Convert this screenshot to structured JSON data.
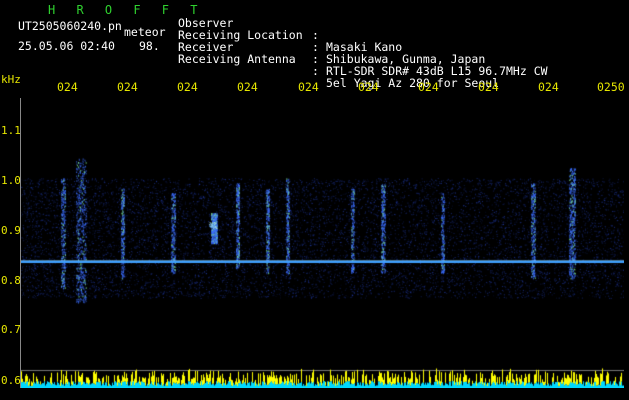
{
  "header": {
    "brand": "H R O F F T",
    "filename": "UT2505060240.pn",
    "meteor_tag": "meteor",
    "date_time": "25.05.06 02:40",
    "count": "98.",
    "observer": {
      "label": "Observer",
      "value": "Masaki Kano"
    },
    "location": {
      "label": "Receiving Location",
      "value": "Shibukawa, Gunma, Japan"
    },
    "receiver": {
      "label": "Receiver",
      "value": "RTL-SDR SDR# 43dB L15 96.7MHz CW"
    },
    "antenna": {
      "label": "Receiving Antenna",
      "value": "5el Yagi Az 280 for Seoul"
    },
    "separator": ":"
  },
  "axis": {
    "y_unit": "kHz",
    "time_labels": [
      "024",
      "024",
      "024",
      "024",
      "024",
      "024",
      "024",
      "024",
      "024",
      "0250"
    ],
    "freq_labels": [
      "1.1",
      "1.0",
      "0.9",
      "0.8",
      "0.7",
      "0.6"
    ]
  },
  "colors": {
    "brand": "#2fd12f",
    "labels": "#e6e600",
    "text": "#ffffff",
    "background": "#000000",
    "signal_line": "#3fa0ff",
    "noise": "#1a2f9a",
    "bar_cyan": "#00d8ff",
    "bar_yellow": "#ffff00"
  }
}
